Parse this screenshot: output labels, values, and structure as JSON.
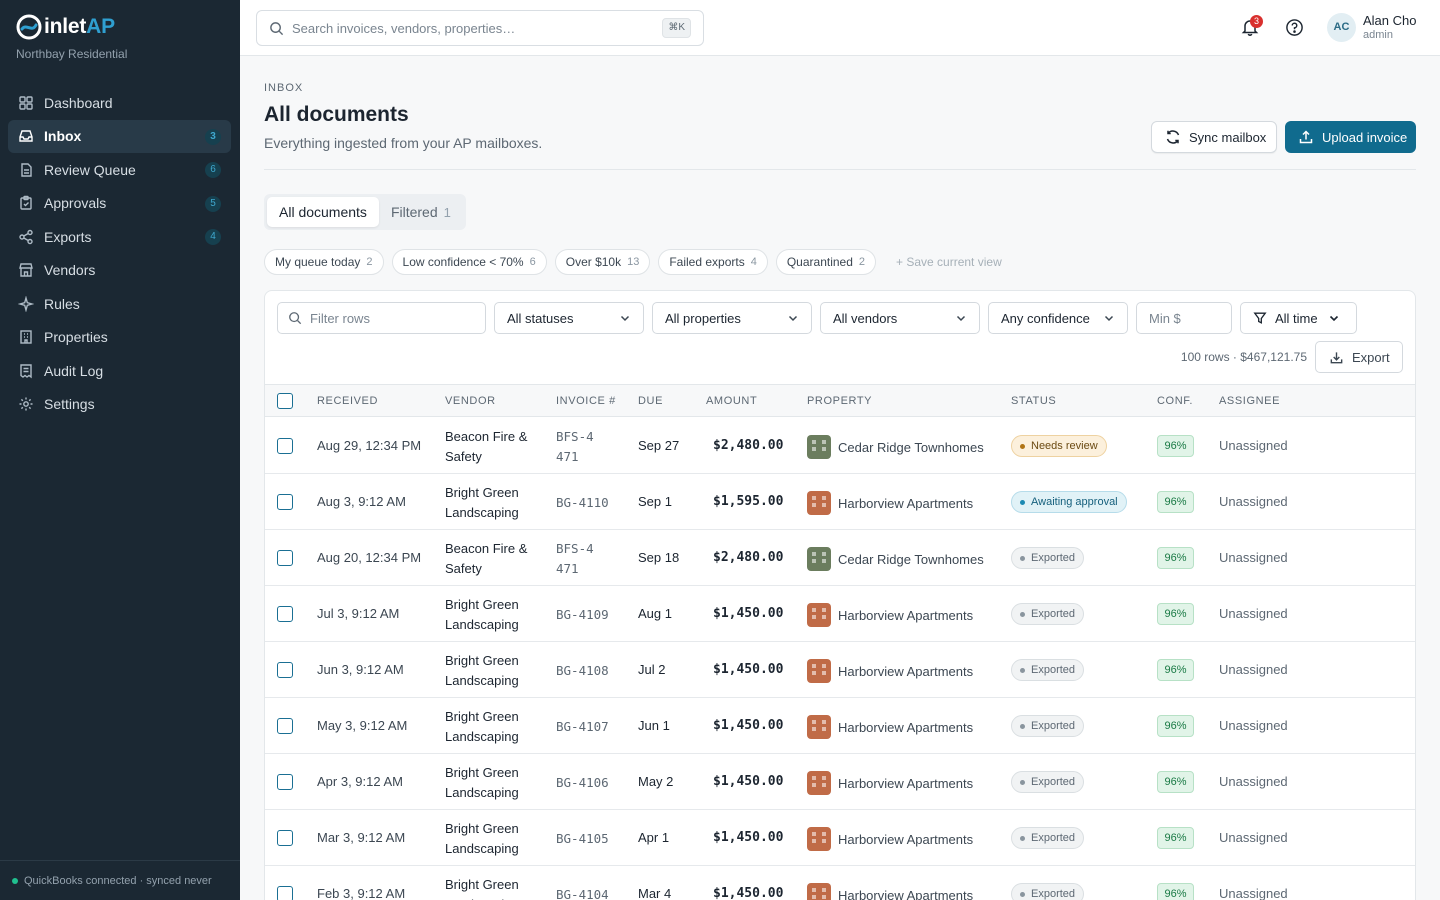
{
  "app": {
    "name_prefix": "inlet",
    "name_suffix": "AP",
    "org": "Northbay Residential"
  },
  "colors": {
    "sidebar_bg": "#1b2833",
    "primary": "#106b8e",
    "accent": "#2f9fd0",
    "warning": "#b07416",
    "success": "#1a7a45"
  },
  "sidebar": {
    "items": [
      {
        "label": "Dashboard",
        "icon": "dashboard-icon",
        "count": ""
      },
      {
        "label": "Inbox",
        "icon": "inbox-icon",
        "count": "3",
        "active": true
      },
      {
        "label": "Review Queue",
        "icon": "document-icon",
        "count": "6"
      },
      {
        "label": "Approvals",
        "icon": "clipboard-check-icon",
        "count": "5"
      },
      {
        "label": "Exports",
        "icon": "share-icon",
        "count": "4"
      },
      {
        "label": "Vendors",
        "icon": "store-icon",
        "count": ""
      },
      {
        "label": "Rules",
        "icon": "sparkle-icon",
        "count": ""
      },
      {
        "label": "Properties",
        "icon": "building-icon",
        "count": ""
      },
      {
        "label": "Audit Log",
        "icon": "receipt-icon",
        "count": ""
      },
      {
        "label": "Settings",
        "icon": "gear-icon",
        "count": ""
      }
    ],
    "footer": "QuickBooks connected · synced never"
  },
  "topbar": {
    "search_placeholder": "Search invoices, vendors, properties…",
    "search_shortcut": "⌘K",
    "notification_count": "3",
    "user": {
      "initials": "AC",
      "name": "Alan Cho",
      "role": "admin"
    }
  },
  "header": {
    "eyebrow": "INBOX",
    "title": "All documents",
    "subtitle": "Everything ingested from your AP mailboxes.",
    "sync_label": "Sync mailbox",
    "upload_label": "Upload invoice"
  },
  "tabs": [
    {
      "label": "All documents",
      "count": ""
    },
    {
      "label": "Filtered",
      "count": "1"
    }
  ],
  "saved_views": [
    {
      "label": "My queue today",
      "count": "2"
    },
    {
      "label": "Low confidence < 70%",
      "count": "6"
    },
    {
      "label": "Over $10k",
      "count": "13"
    },
    {
      "label": "Failed exports",
      "count": "4"
    },
    {
      "label": "Quarantined",
      "count": "2"
    }
  ],
  "save_view_label": "+ Save current view",
  "filters": {
    "row_filter_placeholder": "Filter rows",
    "status": "All statuses",
    "property": "All properties",
    "vendor": "All vendors",
    "confidence": "Any confidence",
    "min_placeholder": "Min $",
    "time": "All time"
  },
  "summary": "100 rows · $467,121.75",
  "export_label": "Export",
  "columns": [
    "RECEIVED",
    "VENDOR",
    "INVOICE #",
    "DUE",
    "AMOUNT",
    "PROPERTY",
    "STATUS",
    "CONF.",
    "ASSIGNEE"
  ],
  "rows": [
    {
      "received": "Aug 29, 12:34 PM",
      "vendor": "Beacon Fire & Safety",
      "invoice": "BFS-4471",
      "due": "Sep 27",
      "amount": "$2,480.00",
      "property": "Cedar Ridge Townhomes",
      "status": "Needs review",
      "conf": "96%",
      "assignee": "Unassigned"
    },
    {
      "received": "Aug 3, 9:12 AM",
      "vendor": "Bright Green Landscaping",
      "invoice": "BG-4110",
      "due": "Sep 1",
      "amount": "$1,595.00",
      "property": "Harborview Apartments",
      "status": "Awaiting approval",
      "conf": "96%",
      "assignee": "Unassigned"
    },
    {
      "received": "Aug 20, 12:34 PM",
      "vendor": "Beacon Fire & Safety",
      "invoice": "BFS-4471",
      "due": "Sep 18",
      "amount": "$2,480.00",
      "property": "Cedar Ridge Townhomes",
      "status": "Exported",
      "conf": "96%",
      "assignee": "Unassigned"
    },
    {
      "received": "Jul 3, 9:12 AM",
      "vendor": "Bright Green Landscaping",
      "invoice": "BG-4109",
      "due": "Aug 1",
      "amount": "$1,450.00",
      "property": "Harborview Apartments",
      "status": "Exported",
      "conf": "96%",
      "assignee": "Unassigned"
    },
    {
      "received": "Jun 3, 9:12 AM",
      "vendor": "Bright Green Landscaping",
      "invoice": "BG-4108",
      "due": "Jul 2",
      "amount": "$1,450.00",
      "property": "Harborview Apartments",
      "status": "Exported",
      "conf": "96%",
      "assignee": "Unassigned"
    },
    {
      "received": "May 3, 9:12 AM",
      "vendor": "Bright Green Landscaping",
      "invoice": "BG-4107",
      "due": "Jun 1",
      "amount": "$1,450.00",
      "property": "Harborview Apartments",
      "status": "Exported",
      "conf": "96%",
      "assignee": "Unassigned"
    },
    {
      "received": "Apr 3, 9:12 AM",
      "vendor": "Bright Green Landscaping",
      "invoice": "BG-4106",
      "due": "May 2",
      "amount": "$1,450.00",
      "property": "Harborview Apartments",
      "status": "Exported",
      "conf": "96%",
      "assignee": "Unassigned"
    },
    {
      "received": "Mar 3, 9:12 AM",
      "vendor": "Bright Green Landscaping",
      "invoice": "BG-4105",
      "due": "Apr 1",
      "amount": "$1,450.00",
      "property": "Harborview Apartments",
      "status": "Exported",
      "conf": "96%",
      "assignee": "Unassigned"
    },
    {
      "received": "Feb 3, 9:12 AM",
      "vendor": "Bright Green Landscaping",
      "invoice": "BG-4104",
      "due": "Mar 4",
      "amount": "$1,450.00",
      "property": "Harborview Apartments",
      "status": "Exported",
      "conf": "96%",
      "assignee": "Unassigned"
    }
  ]
}
